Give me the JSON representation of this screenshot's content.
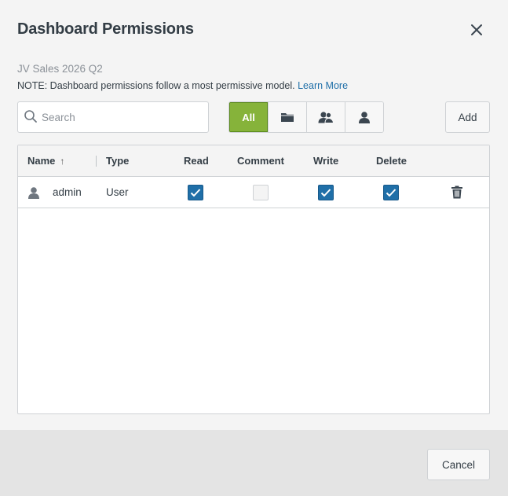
{
  "dialog": {
    "title": "Dashboard Permissions",
    "subtitle": "JV Sales 2026 Q2",
    "note_text": "NOTE: Dashboard permissions follow a most permissive model.",
    "note_link": "Learn More"
  },
  "toolbar": {
    "search_placeholder": "Search",
    "search_value": "",
    "filters": [
      {
        "label": "All",
        "icon": "all",
        "active": true
      },
      {
        "label": "",
        "icon": "folder-icon",
        "active": false
      },
      {
        "label": "",
        "icon": "group-icon",
        "active": false
      },
      {
        "label": "",
        "icon": "user-icon",
        "active": false
      }
    ],
    "add_label": "Add"
  },
  "table": {
    "columns": {
      "name": "Name",
      "type": "Type",
      "read": "Read",
      "comment": "Comment",
      "write": "Write",
      "delete": "Delete"
    },
    "sort": {
      "column": "name",
      "direction": "ascending",
      "glyph": "↑"
    },
    "rows": [
      {
        "icon": "user-icon",
        "name": "admin",
        "type": "User",
        "read": true,
        "comment": false,
        "write": true,
        "delete": true
      }
    ]
  },
  "footer": {
    "cancel_label": "Cancel"
  },
  "colors": {
    "accent_green": "#86b33a",
    "checkbox_blue": "#1f6fa8",
    "link_blue": "#1f6fa8"
  }
}
